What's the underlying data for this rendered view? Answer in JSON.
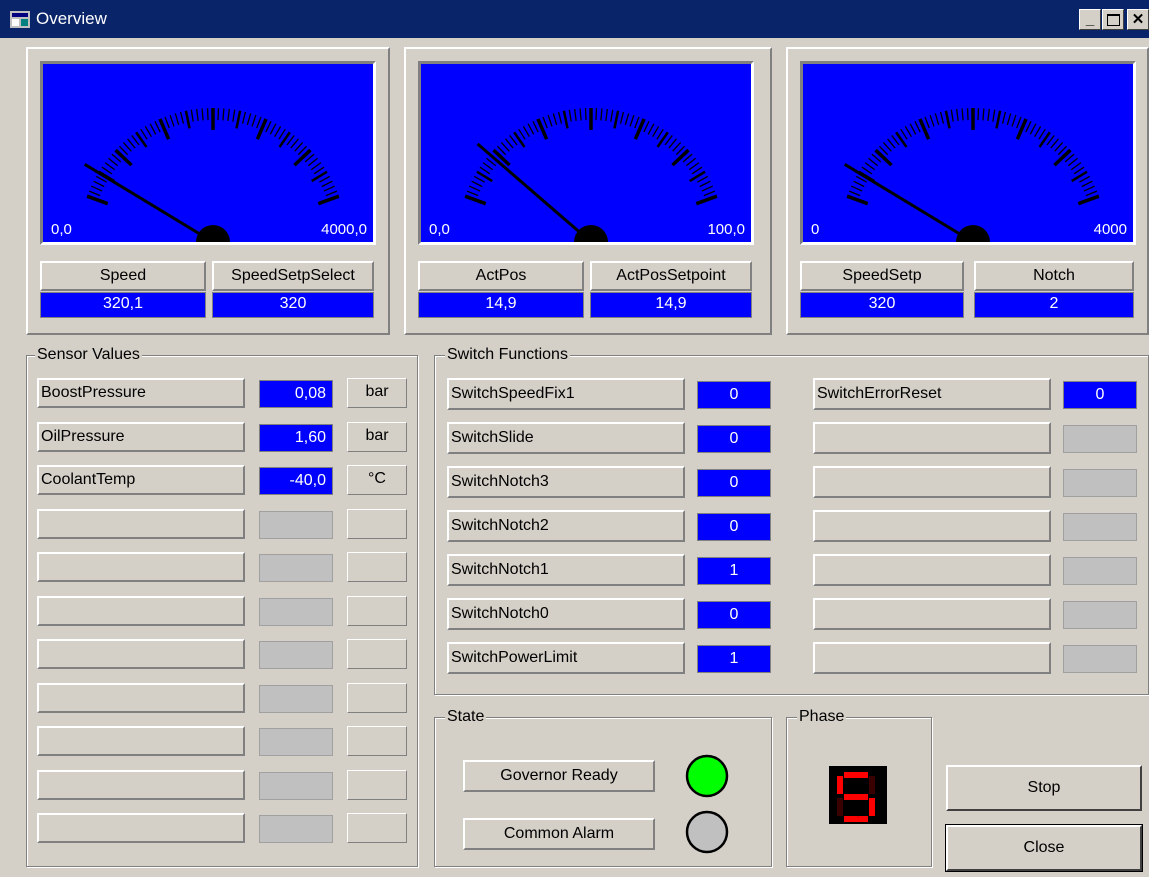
{
  "window": {
    "title": "Overview"
  },
  "gauges": [
    {
      "min_label": "0,0",
      "max_label": "4000,0",
      "min": 0,
      "max": 4000,
      "value": 320.1
    },
    {
      "min_label": "0,0",
      "max_label": "100,0",
      "min": 0,
      "max": 100,
      "value": 14.9
    },
    {
      "min_label": "0",
      "max_label": "4000",
      "min": 0,
      "max": 4000,
      "value": 320
    }
  ],
  "readouts": [
    {
      "label": "Speed",
      "value": "320,1"
    },
    {
      "label": "SpeedSetpSelect",
      "value": "320"
    },
    {
      "label": "ActPos",
      "value": "14,9"
    },
    {
      "label": "ActPosSetpoint",
      "value": "14,9"
    },
    {
      "label": "SpeedSetp",
      "value": "320"
    },
    {
      "label": "Notch",
      "value": "2"
    }
  ],
  "sensor": {
    "title": "Sensor Values",
    "rows": [
      {
        "name": "BoostPressure",
        "value": "0,08",
        "unit": "bar"
      },
      {
        "name": "OilPressure",
        "value": "1,60",
        "unit": "bar"
      },
      {
        "name": "CoolantTemp",
        "value": "-40,0",
        "unit": "°C"
      }
    ]
  },
  "switches": {
    "title": "Switch Functions",
    "left": [
      {
        "name": "SwitchSpeedFix1",
        "value": "0"
      },
      {
        "name": "SwitchSlide",
        "value": "0"
      },
      {
        "name": "SwitchNotch3",
        "value": "0"
      },
      {
        "name": "SwitchNotch2",
        "value": "0"
      },
      {
        "name": "SwitchNotch1",
        "value": "1"
      },
      {
        "name": "SwitchNotch0",
        "value": "0"
      },
      {
        "name": "SwitchPowerLimit",
        "value": "1"
      }
    ],
    "right": [
      {
        "name": "SwitchErrorReset",
        "value": "0"
      }
    ]
  },
  "state": {
    "title": "State",
    "items": [
      {
        "label": "Governor Ready",
        "led_color": "#00ff00"
      },
      {
        "label": "Common Alarm",
        "led_color": "#c0c0c0"
      }
    ]
  },
  "phase": {
    "title": "Phase",
    "digit": "5",
    "digit_color": "#ff0000"
  },
  "buttons": {
    "stop": "Stop",
    "close": "Close"
  },
  "colors": {
    "title_bar": "#0a246a",
    "value_bg": "#0000ff",
    "gauge_face": "#0000ff",
    "window_bg": "#d4d0c8"
  }
}
